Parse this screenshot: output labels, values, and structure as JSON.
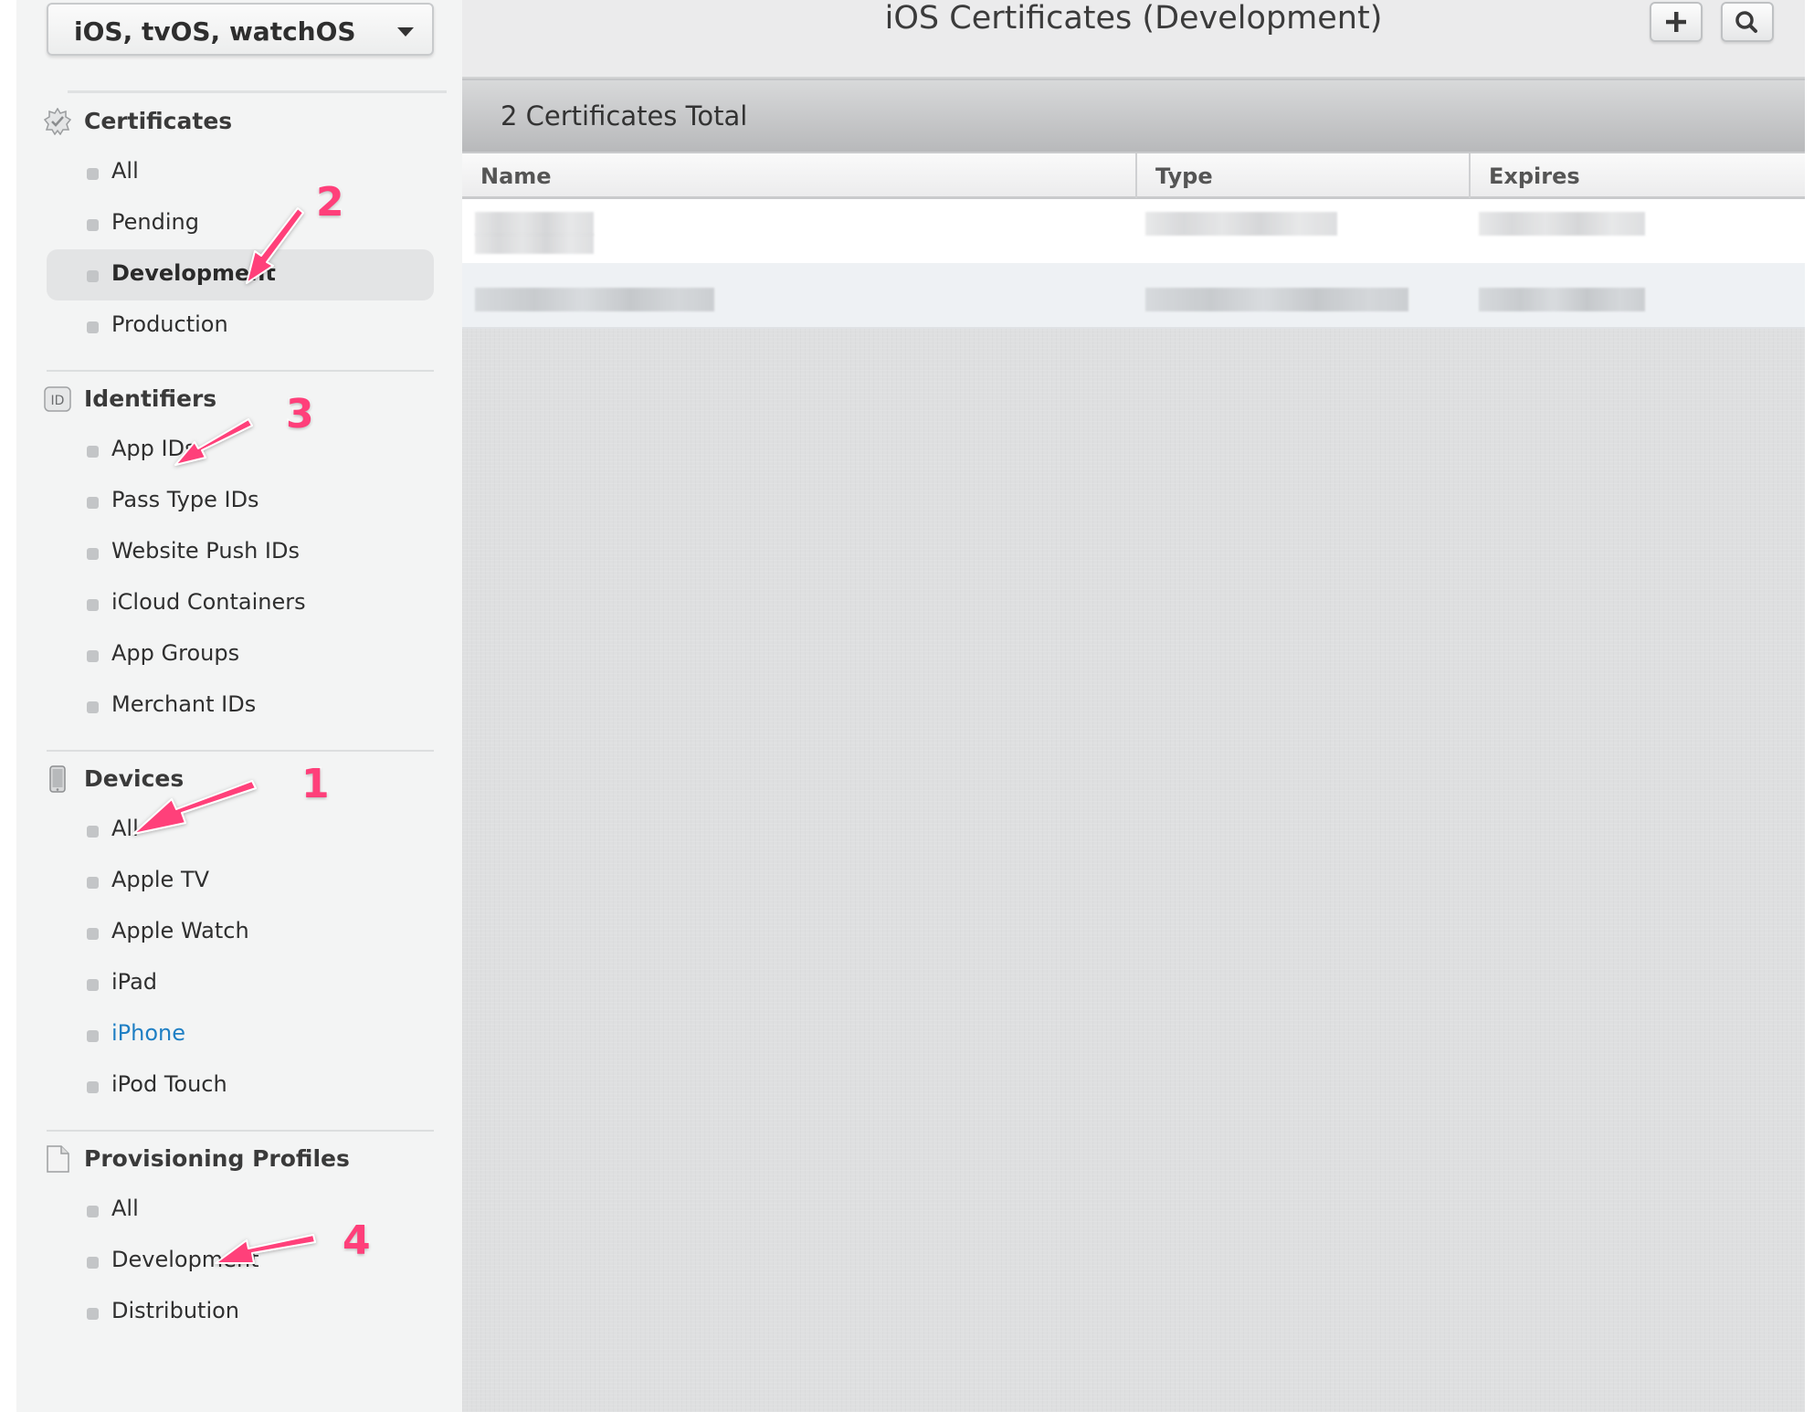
{
  "sidebar": {
    "platform_select": "iOS, tvOS, watchOS",
    "sections": {
      "certificates": {
        "title": "Certificates",
        "items": [
          "All",
          "Pending",
          "Development",
          "Production"
        ]
      },
      "identifiers": {
        "title": "Identifiers",
        "icon_label": "ID",
        "items": [
          "App IDs",
          "Pass Type IDs",
          "Website Push IDs",
          "iCloud Containers",
          "App Groups",
          "Merchant IDs"
        ]
      },
      "devices": {
        "title": "Devices",
        "items": [
          "All",
          "Apple TV",
          "Apple Watch",
          "iPad",
          "iPhone",
          "iPod Touch"
        ]
      },
      "profiles": {
        "title": "Provisioning Profiles",
        "items": [
          "All",
          "Development",
          "Distribution"
        ]
      }
    },
    "selected_item": "Development",
    "link_item": "iPhone"
  },
  "main": {
    "title": "iOS Certificates (Development)",
    "count_text": "2 Certificates Total",
    "columns": [
      "Name",
      "Type",
      "Expires"
    ],
    "rows_redacted": true
  },
  "annotations": [
    "1",
    "2",
    "3",
    "4"
  ],
  "colors": {
    "annotation": "#ff3f7a",
    "link": "#1f7fc4",
    "selected_bg": "#e3e4e5"
  }
}
